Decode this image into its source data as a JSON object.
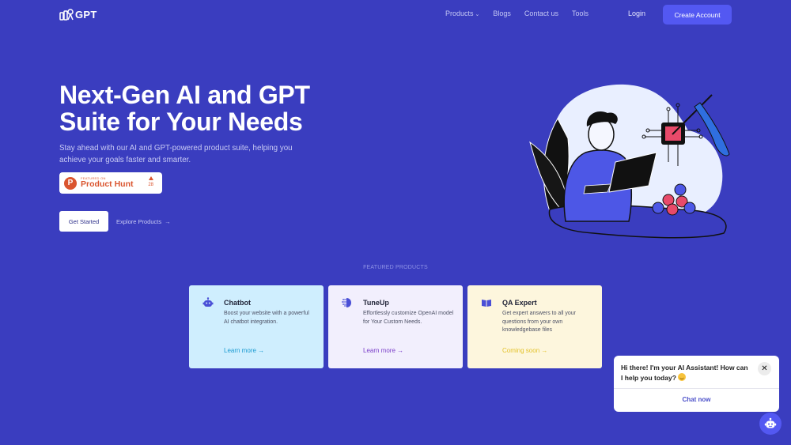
{
  "nav": {
    "logo_text": "GPT",
    "links": [
      {
        "label": "Products",
        "has_dropdown": true
      },
      {
        "label": "Blogs"
      },
      {
        "label": "Contact us"
      },
      {
        "label": "Tools"
      }
    ],
    "login_label": "Login",
    "create_account_label": "Create Account"
  },
  "hero": {
    "title_line1": "Next-Gen AI and GPT",
    "title_line2": "Suite for Your Needs",
    "subtitle": "Stay ahead with our AI and GPT-powered product suite, helping you achieve your goals faster and smarter.",
    "product_hunt": {
      "small_label": "FEATURED ON",
      "big_label": "Product Hunt",
      "logo_letter": "P",
      "upvotes": "28"
    },
    "get_started_label": "Get Started",
    "explore_label": "Explore Products",
    "explore_arrow": "→"
  },
  "featured": {
    "section_label": "FEATURED PRODUCTS",
    "cards": [
      {
        "title": "Chatbot",
        "description": "Boost your website with a powerful AI chatbot integration.",
        "link": "Learn more →",
        "icon": "robot-icon",
        "color": "#cfeefe"
      },
      {
        "title": "TuneUp",
        "description": "Effortlessly customize OpenAI model for Your Custom Needs.",
        "link": "Learn more →",
        "icon": "brain-circuit-icon",
        "color": "#f2effd"
      },
      {
        "title": "QA Expert",
        "description": "Get expert answers to all your questions from your own knowledgebase files",
        "link": "Coming soon →",
        "icon": "book-icon",
        "color": "#fdf6dd"
      }
    ]
  },
  "chat": {
    "message": "Hi there! I'm your AI Assistant! How can I help you today?",
    "close_label": "✕",
    "cta_label": "Chat now"
  },
  "colors": {
    "background": "#3a3dbf",
    "accent": "#5358f2",
    "product_hunt": "#da552f"
  }
}
